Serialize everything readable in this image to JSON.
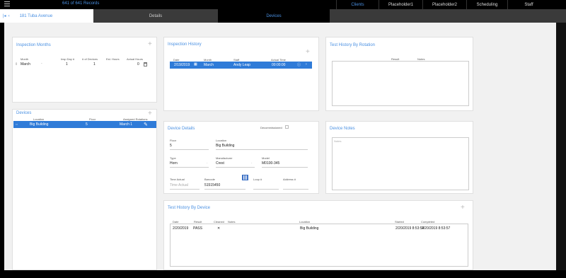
{
  "header": {
    "records": "641 of 641 Records",
    "nav": [
      "Clients",
      "Placeholder1",
      "Placeholder2",
      "Scheduling",
      "Staff"
    ],
    "address": "181 Tuba Avenue",
    "tabs": {
      "details": "Details",
      "devices": "Devices"
    }
  },
  "inspection_months": {
    "title": "Inspection Months",
    "columns": [
      "Month",
      "Insp Day #",
      "# of Devices",
      "Est. Hours",
      "Actual Hours"
    ],
    "row": {
      "month": "March",
      "insp_day": "1",
      "devices": "1",
      "actual": "0"
    }
  },
  "devices": {
    "title": "Devices",
    "columns": [
      "Location",
      "Floor",
      "Assigned Rotations"
    ],
    "row": {
      "location": "Big Building",
      "floor": "5",
      "rotation": "March 1"
    }
  },
  "inspection_history": {
    "title": "Inspection History",
    "columns": [
      "Date",
      "Month",
      "Staff",
      "Actual Time"
    ],
    "row": {
      "date": "2/19/2019",
      "month": "March",
      "staff": "Andy Leap",
      "time": "00:00:00"
    }
  },
  "test_history_rotation": {
    "title": "Test History By Rotation",
    "columns": [
      "Result",
      "Notes"
    ]
  },
  "device_details": {
    "title": "Device Details",
    "decommissioned_label": "Decommissioned",
    "floor_label": "Floor",
    "floor": "5",
    "location_label": "Location",
    "location": "Big Building",
    "type_label": "Type",
    "type": "Horn",
    "manufacturer_label": "Manufacturer",
    "manufacturer": "Crest",
    "model_label": "Model",
    "model": "M0100-345",
    "time_actual_label": "Time Actual",
    "time_actual_placeholder": "Time Actual",
    "barcode_label": "Barcode",
    "barcode": "51515450",
    "loop_label": "Loop #",
    "address_label": "Address #"
  },
  "device_notes": {
    "title": "Device Notes",
    "placeholder": "Notes"
  },
  "test_history_device": {
    "title": "Test History By Device",
    "columns": [
      "Date",
      "Result",
      "Cleaned",
      "Notes",
      "Location",
      "Started",
      "Completed"
    ],
    "row": {
      "date": "2/20/2019",
      "result": "PASS",
      "cleaned": "✕",
      "location": "Big Building",
      "started": "2/20/2019 8:53:54",
      "completed": "2/20/2019 8:53:57"
    }
  },
  "colors": {
    "accent": "#4a90e2",
    "selected_row": "#2f7bd8",
    "background": "#f1f1f1"
  }
}
